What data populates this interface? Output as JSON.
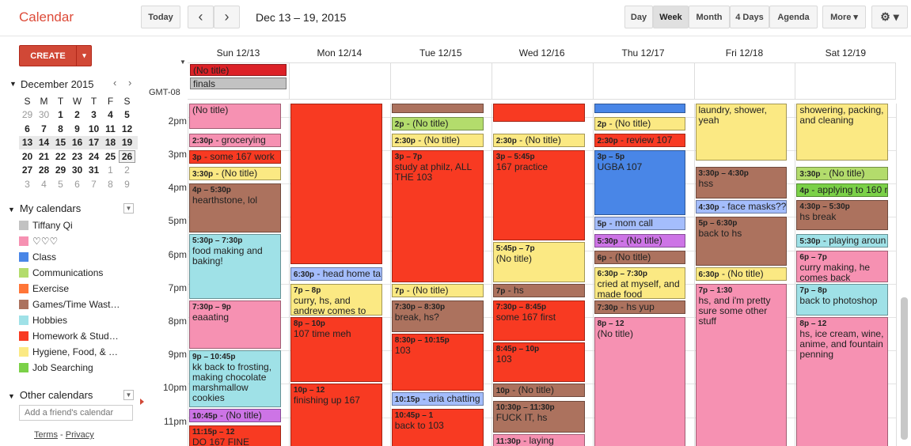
{
  "app_title": "Calendar",
  "toolbar": {
    "today": "Today",
    "prev": "‹",
    "next": "›",
    "range": "Dec 13 – 19, 2015",
    "views": [
      "Day",
      "Week",
      "Month",
      "4 Days",
      "Agenda"
    ],
    "more": "More ▾",
    "settings": "⚙ ▾"
  },
  "create": {
    "label": "CREATE",
    "dropdown": "▾"
  },
  "mini_cal": {
    "title": "December 2015",
    "dow": [
      "S",
      "M",
      "T",
      "W",
      "T",
      "F",
      "S"
    ],
    "weeks": [
      [
        "29",
        "30",
        "1",
        "2",
        "3",
        "4",
        "5"
      ],
      [
        "6",
        "7",
        "8",
        "9",
        "10",
        "11",
        "12"
      ],
      [
        "13",
        "14",
        "15",
        "16",
        "17",
        "18",
        "19"
      ],
      [
        "20",
        "21",
        "22",
        "23",
        "24",
        "25",
        "26"
      ],
      [
        "27",
        "28",
        "29",
        "30",
        "31",
        "1",
        "2"
      ],
      [
        "3",
        "4",
        "5",
        "6",
        "7",
        "8",
        "9"
      ]
    ]
  },
  "my_calendars": {
    "title": "My calendars",
    "items": [
      {
        "label": "Tiffany Qi",
        "color": "#c2c2c2"
      },
      {
        "label": "♡♡♡",
        "color": "#f691b2"
      },
      {
        "label": "Class",
        "color": "#4986e7"
      },
      {
        "label": "Communications",
        "color": "#b3dc6c"
      },
      {
        "label": "Exercise",
        "color": "#ff7537"
      },
      {
        "label": "Games/Time Wast…",
        "color": "#ac725e"
      },
      {
        "label": "Hobbies",
        "color": "#9fe1e7"
      },
      {
        "label": "Homework & Stud…",
        "color": "#f83a22"
      },
      {
        "label": "Hygiene, Food, & …",
        "color": "#fbe983"
      },
      {
        "label": "Job Searching",
        "color": "#7bd148"
      }
    ]
  },
  "other_calendars": {
    "title": "Other calendars",
    "placeholder": "Add a friend's calendar"
  },
  "footer": {
    "terms": "Terms",
    "sep": " - ",
    "privacy": "Privacy"
  },
  "timezone": "GMT-08",
  "days": [
    "Sun 12/13",
    "Mon 12/14",
    "Tue 12/15",
    "Wed 12/16",
    "Thu 12/17",
    "Fri 12/18",
    "Sat 12/19"
  ],
  "allday": [
    {
      "label": "(No title)",
      "color": "#dc2127"
    },
    {
      "label": "finals",
      "color": "#c2c2c2"
    }
  ],
  "hour_labels": [
    "2pm",
    "3pm",
    "4pm",
    "5pm",
    "6pm",
    "7pm",
    "8pm",
    "9pm",
    "10pm",
    "11pm"
  ],
  "events": [
    {
      "day": 0,
      "s": 1.6,
      "e": 2.4,
      "time": "",
      "title": "(No title)",
      "color": "#f691b2"
    },
    {
      "day": 0,
      "s": 2.5,
      "e": 2.95,
      "time": "2:30p",
      "title": "grocerying",
      "color": "#f691b2",
      "inline": true
    },
    {
      "day": 0,
      "s": 3,
      "e": 3.45,
      "time": "3p",
      "title": "some 167 work",
      "color": "#f83a22",
      "inline": true
    },
    {
      "day": 0,
      "s": 3.5,
      "e": 3.95,
      "time": "3:30p",
      "title": "(No title)",
      "color": "#fbe983",
      "inline": true
    },
    {
      "day": 0,
      "s": 4,
      "e": 5.5,
      "time": "4p – 5:30p",
      "title": "hearthstone, lol",
      "color": "#ac725e"
    },
    {
      "day": 0,
      "s": 5.5,
      "e": 7.5,
      "time": "5:30p – 7:30p",
      "title": "food making and baking!",
      "color": "#9fe1e7"
    },
    {
      "day": 0,
      "s": 7.5,
      "e": 9,
      "time": "7:30p – 9p",
      "title": "eaaating",
      "color": "#f691b2"
    },
    {
      "day": 0,
      "s": 9,
      "e": 10.75,
      "time": "9p – 10:45p",
      "title": "kk back to frosting, making chocolate marshmallow cookies",
      "color": "#9fe1e7"
    },
    {
      "day": 0,
      "s": 10.75,
      "e": 11.2,
      "time": "10:45p",
      "title": "(No title)",
      "color": "#cd74e6",
      "inline": true
    },
    {
      "day": 0,
      "s": 11.25,
      "e": 12,
      "time": "11:15p – 12",
      "title": "DO 167 FINE",
      "color": "#f83a22"
    },
    {
      "day": 1,
      "s": 1.6,
      "e": 6.45,
      "time": "",
      "title": "",
      "color": "#f83a22"
    },
    {
      "day": 1,
      "s": 6.5,
      "e": 6.95,
      "time": "6:30p",
      "title": "head home ta",
      "color": "#a4bdfc",
      "inline": true
    },
    {
      "day": 1,
      "s": 7,
      "e": 8,
      "time": "7p – 8p",
      "title": "curry, hs, and andrew comes to",
      "color": "#fbe983"
    },
    {
      "day": 1,
      "s": 8,
      "e": 10,
      "time": "8p – 10p",
      "title": "107 time meh",
      "color": "#f83a22"
    },
    {
      "day": 1,
      "s": 10,
      "e": 12,
      "time": "10p – 12",
      "title": "finishing up 167",
      "color": "#f83a22"
    },
    {
      "day": 2,
      "s": 1.6,
      "e": 1.85,
      "time": "",
      "title": "",
      "color": "#ac725e"
    },
    {
      "day": 2,
      "s": 2,
      "e": 2.45,
      "time": "2p",
      "title": "(No title)",
      "color": "#b3dc6c",
      "inline": true
    },
    {
      "day": 2,
      "s": 2.5,
      "e": 2.95,
      "time": "2:30p",
      "title": "(No title)",
      "color": "#fbe983",
      "inline": true
    },
    {
      "day": 2,
      "s": 3,
      "e": 7,
      "time": "3p – 7p",
      "title": "study at philz, ALL THE 103",
      "color": "#f83a22"
    },
    {
      "day": 2,
      "s": 7,
      "e": 7.45,
      "time": "7p",
      "title": "(No title)",
      "color": "#fbe983",
      "inline": true
    },
    {
      "day": 2,
      "s": 7.5,
      "e": 8.5,
      "time": "7:30p – 8:30p",
      "title": "break, hs?",
      "color": "#ac725e"
    },
    {
      "day": 2,
      "s": 8.5,
      "e": 10.25,
      "time": "8:30p – 10:15p",
      "title": "103",
      "color": "#f83a22"
    },
    {
      "day": 2,
      "s": 10.25,
      "e": 10.7,
      "time": "10:15p",
      "title": "aria chatting",
      "color": "#a4bdfc",
      "inline": true
    },
    {
      "day": 2,
      "s": 10.75,
      "e": 12,
      "time": "10:45p – 1",
      "title": "back to 103",
      "color": "#f83a22"
    },
    {
      "day": 3,
      "s": 1.6,
      "e": 2.2,
      "time": "",
      "title": "",
      "color": "#f83a22"
    },
    {
      "day": 3,
      "s": 2.5,
      "e": 2.95,
      "time": "2:30p",
      "title": "(No title)",
      "color": "#fbe983",
      "inline": true
    },
    {
      "day": 3,
      "s": 3,
      "e": 5.75,
      "time": "3p – 5:45p",
      "title": "167 practice",
      "color": "#f83a22"
    },
    {
      "day": 3,
      "s": 5.75,
      "e": 7,
      "time": "5:45p – 7p",
      "title": "(No title)",
      "color": "#fbe983"
    },
    {
      "day": 3,
      "s": 7,
      "e": 7.45,
      "time": "7p",
      "title": "hs",
      "color": "#ac725e",
      "inline": true
    },
    {
      "day": 3,
      "s": 7.5,
      "e": 8.75,
      "time": "7:30p – 8:45p",
      "title": "some 167 first",
      "color": "#f83a22"
    },
    {
      "day": 3,
      "s": 8.75,
      "e": 10,
      "time": "8:45p – 10p",
      "title": "103",
      "color": "#f83a22"
    },
    {
      "day": 3,
      "s": 10,
      "e": 10.45,
      "time": "10p",
      "title": "(No title)",
      "color": "#ac725e",
      "inline": true
    },
    {
      "day": 3,
      "s": 10.5,
      "e": 11.5,
      "time": "10:30p – 11:30p",
      "title": "FUCK IT, hs",
      "color": "#ac725e"
    },
    {
      "day": 3,
      "s": 11.5,
      "e": 12,
      "time": "11:30p",
      "title": "laying",
      "color": "#f691b2",
      "inline": true
    },
    {
      "day": 4,
      "s": 1.6,
      "e": 1.85,
      "time": "",
      "title": "",
      "color": "#4986e7"
    },
    {
      "day": 4,
      "s": 2,
      "e": 2.45,
      "time": "2p",
      "title": "(No title)",
      "color": "#fbe983",
      "inline": true
    },
    {
      "day": 4,
      "s": 2.5,
      "e": 2.95,
      "time": "2:30p",
      "title": "review 107",
      "color": "#f83a22",
      "inline": true
    },
    {
      "day": 4,
      "s": 3,
      "e": 5,
      "time": "3p – 5p",
      "title": "UGBA 107",
      "color": "#4986e7"
    },
    {
      "day": 4,
      "s": 5,
      "e": 5.45,
      "time": "5p",
      "title": "mom call",
      "color": "#a4bdfc",
      "inline": true
    },
    {
      "day": 4,
      "s": 5.5,
      "e": 5.95,
      "time": "5:30p",
      "title": "(No title)",
      "color": "#cd74e6",
      "inline": true
    },
    {
      "day": 4,
      "s": 6,
      "e": 6.45,
      "time": "6p",
      "title": "(No title)",
      "color": "#ac725e",
      "inline": true
    },
    {
      "day": 4,
      "s": 6.5,
      "e": 7.5,
      "time": "6:30p – 7:30p",
      "title": "cried at myself, and made food",
      "color": "#fbe983"
    },
    {
      "day": 4,
      "s": 7.5,
      "e": 7.95,
      "time": "7:30p",
      "title": "hs yup",
      "color": "#ac725e",
      "inline": true
    },
    {
      "day": 4,
      "s": 8,
      "e": 12,
      "time": "8p – 12",
      "title": "(No title)",
      "color": "#f691b2"
    },
    {
      "day": 5,
      "s": 1.6,
      "e": 3.35,
      "time": "",
      "title": "laundry, shower, yeah",
      "color": "#fbe983"
    },
    {
      "day": 5,
      "s": 3.5,
      "e": 4.5,
      "time": "3:30p – 4:30p",
      "title": "hss",
      "color": "#ac725e"
    },
    {
      "day": 5,
      "s": 4.5,
      "e": 4.95,
      "time": "4:30p",
      "title": "face masks??",
      "color": "#a4bdfc",
      "inline": true
    },
    {
      "day": 5,
      "s": 5,
      "e": 6.5,
      "time": "5p – 6:30p",
      "title": "back to hs",
      "color": "#ac725e"
    },
    {
      "day": 5,
      "s": 6.5,
      "e": 6.95,
      "time": "6:30p",
      "title": "(No title)",
      "color": "#fbe983",
      "inline": true
    },
    {
      "day": 5,
      "s": 7,
      "e": 12,
      "time": "7p – 1:30",
      "title": "hs, and i'm pretty sure some other stuff",
      "color": "#f691b2"
    },
    {
      "day": 6,
      "s": 1.6,
      "e": 3.35,
      "time": "",
      "title": "showering, packing, and cleaning",
      "color": "#fbe983"
    },
    {
      "day": 6,
      "s": 3.5,
      "e": 3.95,
      "time": "3:30p",
      "title": "(No title)",
      "color": "#b3dc6c",
      "inline": true
    },
    {
      "day": 6,
      "s": 4,
      "e": 4.45,
      "time": "4p",
      "title": "applying to 160 r",
      "color": "#7bd148",
      "inline": true
    },
    {
      "day": 6,
      "s": 4.5,
      "e": 5.45,
      "time": "4:30p – 5:30p",
      "title": "hs break",
      "color": "#ac725e"
    },
    {
      "day": 6,
      "s": 5.5,
      "e": 5.95,
      "time": "5:30p",
      "title": "playing aroun",
      "color": "#9fe1e7",
      "inline": true
    },
    {
      "day": 6,
      "s": 6,
      "e": 7,
      "time": "6p – 7p",
      "title": "curry making, he comes back",
      "color": "#f691b2"
    },
    {
      "day": 6,
      "s": 7,
      "e": 8,
      "time": "7p – 8p",
      "title": "back to photoshop",
      "color": "#9fe1e7"
    },
    {
      "day": 6,
      "s": 8,
      "e": 12,
      "time": "8p – 12",
      "title": "hs, ice cream, wine, anime, and fountain penning",
      "color": "#f691b2"
    }
  ]
}
